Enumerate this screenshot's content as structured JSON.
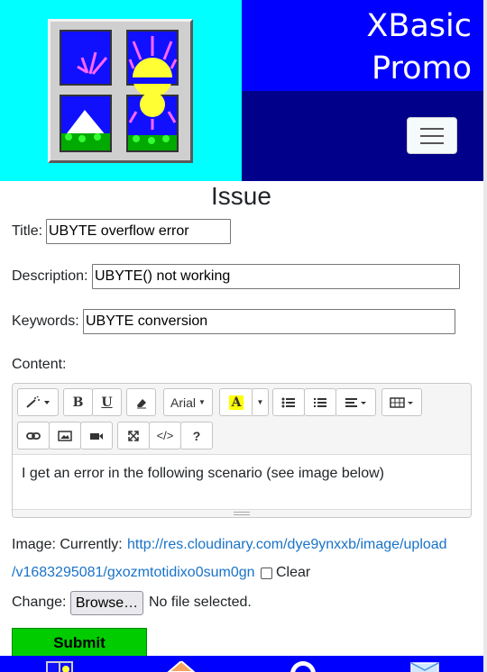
{
  "header": {
    "brand_line1": "XBasic",
    "brand_line2": "Promo",
    "colors": {
      "logo_bg": "#00ffff",
      "brand_top": "#0000ff",
      "brand_bottom": "#00008b"
    }
  },
  "form": {
    "heading": "Issue",
    "title_label": "Title:",
    "title_value": "UBYTE overflow error",
    "description_label": "Description:",
    "description_value": "UBYTE() not working",
    "keywords_label": "Keywords:",
    "keywords_value": "UBYTE conversion",
    "content_label": "Content:",
    "editor": {
      "font_name": "Arial",
      "body_text": "I get an error in the following scenario (see image below)"
    },
    "image_label": "Image: Currently:",
    "image_link_line1": "http://res.cloudinary.com/dye9ynxxb/image/upload",
    "image_link_line2": "/v1683295081/gxozmtotidixo0sum0gn",
    "clear_label": "Clear",
    "change_label": "Change:",
    "browse_label": "Browse…",
    "no_file_text": "No file selected.",
    "submit_label": "Submit"
  },
  "bottom_nav": {
    "icons": [
      "xbasic-icon",
      "home-icon",
      "github-icon",
      "mail-icon"
    ]
  }
}
